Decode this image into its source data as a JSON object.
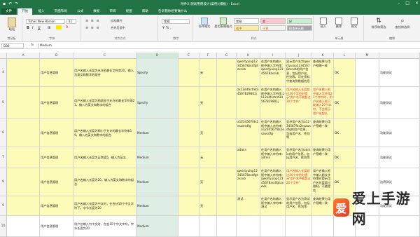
{
  "window": {
    "title": "附件2-测试用例设计(案例)(模板) - Excel"
  },
  "tabs": [
    "文件",
    "开始",
    "插入",
    "页面布局",
    "公式",
    "数据",
    "审阅",
    "视图",
    "帮助",
    "告诉我你想要做什么"
  ],
  "active_tab_index": 1,
  "ribbon": {
    "clipboard": {
      "paste": "粘贴",
      "label": "剪贴板"
    },
    "font": {
      "name": "Times New Roman",
      "size": "11",
      "label": "字体"
    },
    "alignment": {
      "wrap": "自动换行",
      "merge": "合并后居中",
      "label": "对齐方式"
    },
    "number": {
      "format": "常规",
      "label": "数字"
    },
    "styles": {
      "conditional": "条件格式",
      "table": "套用表格格式",
      "normal": "常规",
      "bad": "差",
      "good": "好",
      "neutral": "适中",
      "calc": "计算",
      "check": "检查单元格",
      "label": "样式"
    },
    "cells": {
      "insert": "插入",
      "delete": "删除",
      "format": "格式",
      "label": "单元格"
    },
    "editing": {
      "sort": "排序和筛选",
      "find": "查找和选择",
      "label": "编辑"
    }
  },
  "formula_bar": {
    "name_box": "D36",
    "fx": "fx",
    "value": "Medium"
  },
  "columns": [
    "A",
    "B",
    "C",
    "D",
    "E",
    "F",
    "G",
    "H",
    "I",
    "J",
    "K",
    "L",
    "M"
  ],
  "selected_column": "D",
  "rows": [
    {
      "num": "4",
      "cells": [
        "",
        "用户信息管理",
        "用户名输入长度为允许的最长字符串20，输入为英文和数字的组合",
        "Specify",
        "",
        "无",
        "",
        "qwertyuiop12345678asdfghzxcvb",
        "在用户名的输入框中输入字符串:qwertyuiop12345678zxcvb",
        "显示用户名为qwertyuiop12345678zxcvb的用户信息，包括用户名、性别等，可在资料中查询到数据信息",
        "查询结果与用户预期一致",
        "OK",
        "",
        "功能测试"
      ]
    },
    {
      "num": "5",
      "cells": [
        "",
        "用户信息管理",
        "用户名输入长度为稍超长于允许的最长字符串21，输入为英文和数字的组合",
        "Specify",
        "",
        "无",
        "",
        "zk12edfsrtmt34567829801j",
        "在用户名的输入框中输入字符串:zk12edfsrtmt34567829801j",
        "用户名输入长度超过20个字符时提示'用户名不能超过20个字符'",
        "用户名输入框中输入字符串21个字符时，用户名输入框只能输入20个字符，不会提示用户名超长",
        "OK",
        "",
        "功能测试"
      ]
    },
    {
      "num": "6",
      "cells": [
        "",
        "用户信息管理",
        "用户名输入长度为稍小于允许的最长字符串19，输入为英文和数字的组合",
        "Medium",
        "",
        "无",
        "",
        "a1234567fds2eszwsdfg",
        "在用户名的输入框中输入字符串:a1234567fds2eszwsdfg",
        "显示用户名为a1234567fds2eszwsdfg的用户信息，包括用户名、性别等",
        "查询结果与用户预期一致",
        "OK",
        "",
        "功能测试"
      ]
    },
    {
      "num": "7",
      "cells": [
        "",
        "用户信息管理",
        "用户名输入长度为正常值5，输入为英文",
        "Medium",
        "",
        "无",
        "",
        "admin",
        "在用户名的输入框中输入字符串:admin",
        "显示用户名为admin的用户信息，包括用户名、性别等",
        "查询结果与用户预期一致",
        "OK",
        "",
        "功能测试"
      ]
    },
    {
      "num": "8",
      "cells": [
        "",
        "用户信息管理",
        "用户名输入长度为20，输入为英文和数字的组合",
        "Medium",
        "",
        "无",
        "",
        "qwertyuiop12345678asdfghzxcvb",
        "在用户名的输入框中输入字符串:qwertyuiop12345678asdfghzxcvb",
        "用户名输入长度超过20个字符时提示'用户名不能超过20个字符'",
        "用户名输入框中输入超长字符串时提示用户名长度超过限制，不能提交",
        "OK",
        "",
        "边界测试"
      ]
    },
    {
      "num": "9",
      "cells": [
        "",
        "用户信息管理",
        "用户名输入长度为中文时，在合计10个中文字符下，字节长度为20",
        "Medium",
        "",
        "无",
        "",
        "测试",
        "在用户名的输入框中输入字符串:测试",
        "显示用户名为测试的用户信息，包括用户名、性别等",
        "查询结果与用户预期一致",
        "OK",
        "",
        "功能测试"
      ]
    },
    {
      "num": "10",
      "cells": [
        "",
        "用户信息管理",
        "用户名输入为中文时，包含10个中文字符，字节长度为20",
        "Medium",
        "",
        "",
        "",
        "",
        "",
        "",
        "",
        "",
        "",
        ""
      ]
    }
  ],
  "watermark": {
    "logo": "爱",
    "text": "爱上手游网"
  }
}
